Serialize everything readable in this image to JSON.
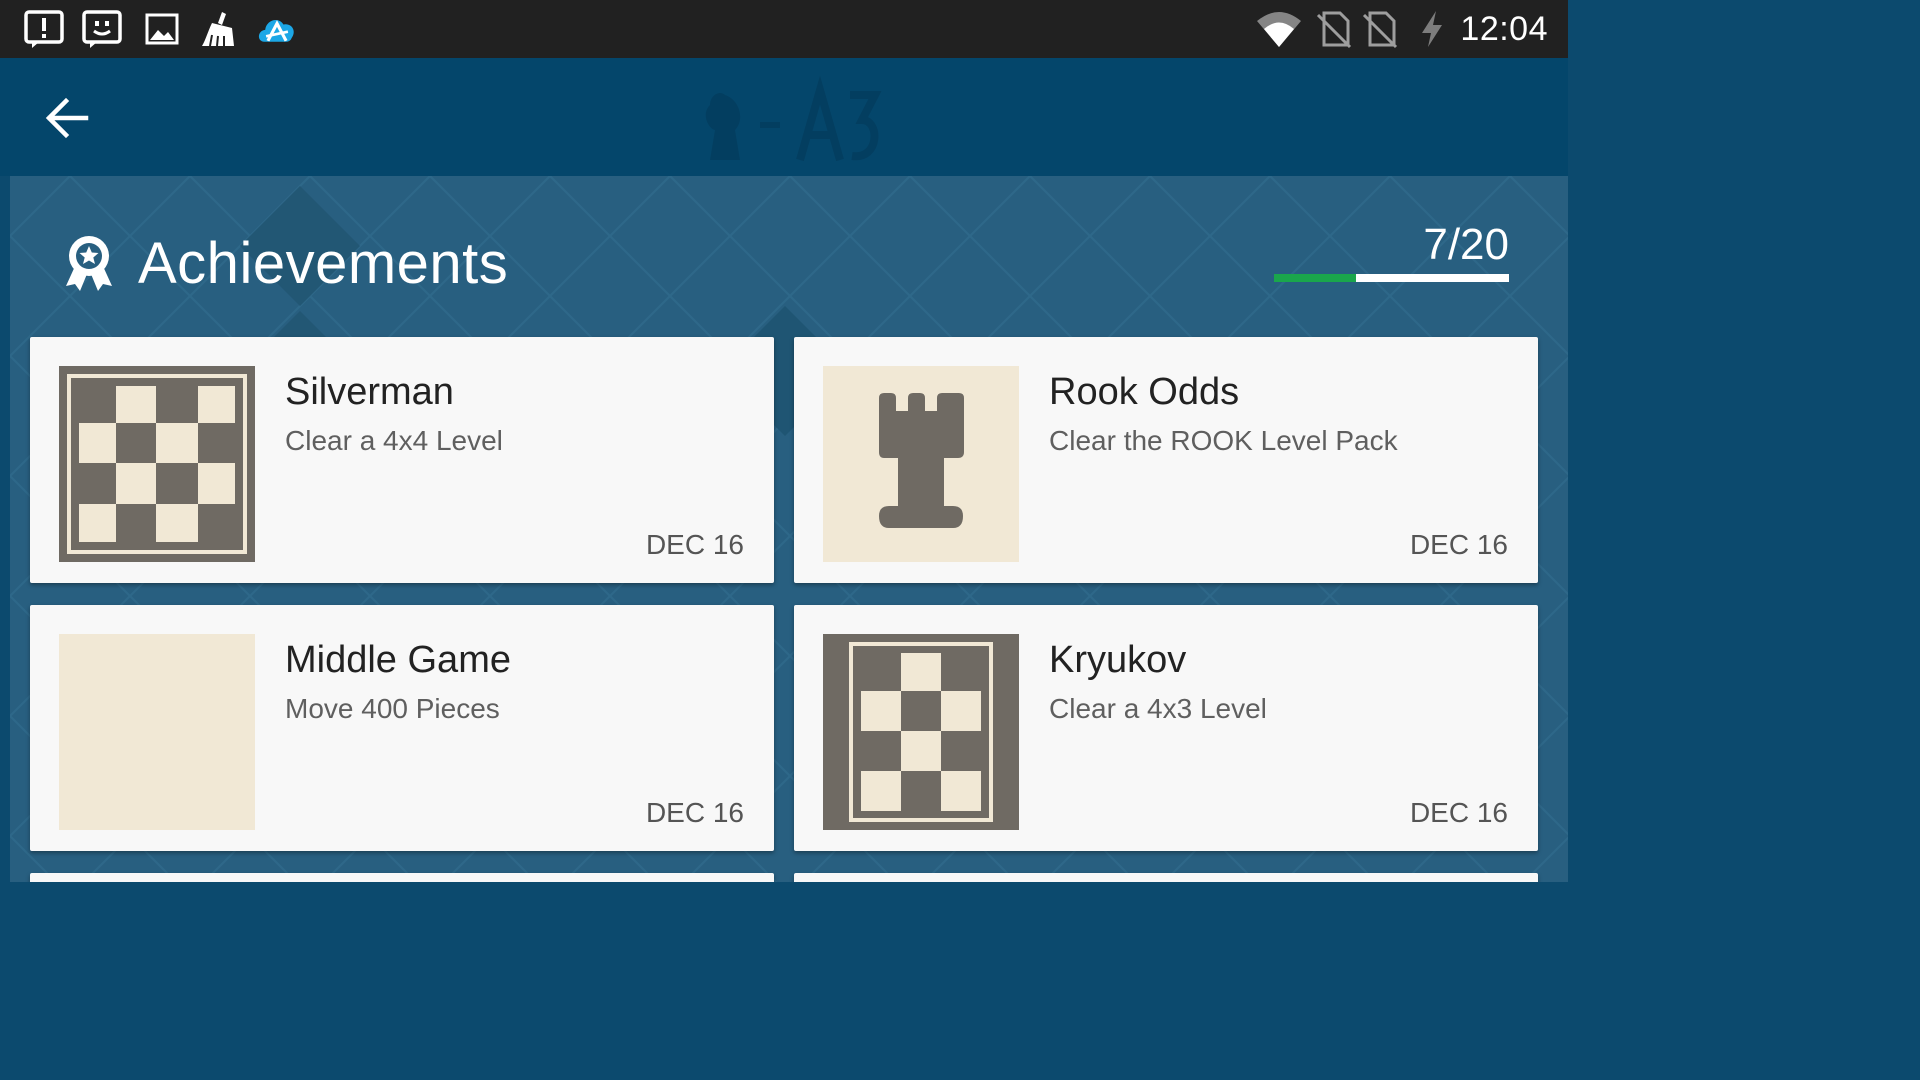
{
  "status_bar": {
    "time": "12:04",
    "left_icons": [
      "alert-notification-icon",
      "face-notification-icon",
      "image-notification-icon",
      "cleaner-notification-icon",
      "cloud-app-notification-icon"
    ],
    "right_icons": [
      "wifi-icon",
      "no-sim-icon",
      "no-sim-icon",
      "charging-icon"
    ]
  },
  "app_bar": {
    "back_icon": "arrow-left-icon"
  },
  "header": {
    "title": "Achievements",
    "icon": "award-ribbon-icon",
    "progress_text": "7/20",
    "progress_value": 0.35,
    "colors": {
      "progress_fill": "#1aa64c",
      "progress_track": "#ffffff"
    }
  },
  "achievements": [
    {
      "title": "Silverman",
      "description": "Clear a 4x4 Level",
      "date": "DEC 16",
      "thumb": "board-4x4-icon"
    },
    {
      "title": "Rook Odds",
      "description": "Clear the ROOK Level Pack",
      "date": "DEC 16",
      "thumb": "rook-icon"
    },
    {
      "title": "Middle Game",
      "description": "Move 400 Pieces",
      "date": "DEC 16",
      "thumb": "blank-tile"
    },
    {
      "title": "Kryukov",
      "description": "Clear a 4x3 Level",
      "date": "DEC 16",
      "thumb": "board-4x3-icon"
    }
  ],
  "colors": {
    "status_bar": "#212121",
    "app_bar": "#04466b",
    "background": "#285f80",
    "card": "#f8f8f8",
    "thumb_dark": "#6f6a63",
    "thumb_light": "#f1e8d5"
  }
}
